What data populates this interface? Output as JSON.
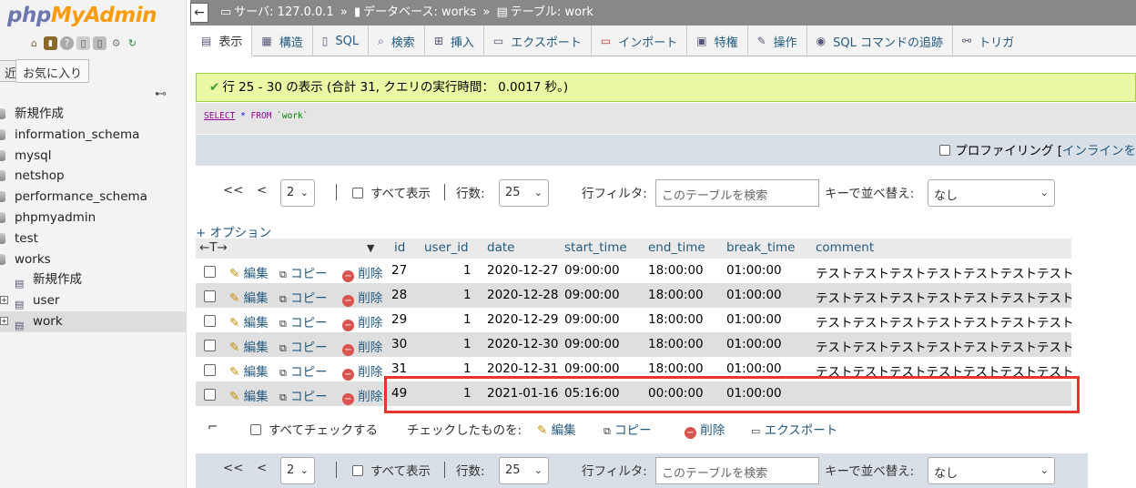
{
  "sidebar": {
    "logo_php": "php",
    "logo_myadmin": "MyAdmin",
    "recent_tab": "近",
    "favorites_tab": "お気に入り",
    "tree": [
      {
        "label": "新規作成"
      },
      {
        "label": "information_schema"
      },
      {
        "label": "mysql"
      },
      {
        "label": "netshop"
      },
      {
        "label": "performance_schema"
      },
      {
        "label": "phpmyadmin"
      },
      {
        "label": "test"
      },
      {
        "label": "works"
      }
    ],
    "subtree": [
      {
        "label": "新規作成"
      },
      {
        "label": "user"
      },
      {
        "label": "work"
      }
    ]
  },
  "topbar": {
    "server": "サーバ: 127.0.0.1",
    "database": "データベース: works",
    "table": "テーブル: work"
  },
  "tabs": [
    {
      "label": "表示",
      "icon": "browse-icon"
    },
    {
      "label": "構造",
      "icon": "structure-icon"
    },
    {
      "label": "SQL",
      "icon": "sql-icon"
    },
    {
      "label": "検索",
      "icon": "search-icon"
    },
    {
      "label": "挿入",
      "icon": "insert-icon"
    },
    {
      "label": "エクスポート",
      "icon": "export-icon"
    },
    {
      "label": "インポート",
      "icon": "import-icon"
    },
    {
      "label": "特権",
      "icon": "privileges-icon"
    },
    {
      "label": "操作",
      "icon": "operations-icon"
    },
    {
      "label": "SQL コマンドの追跡",
      "icon": "tracking-icon"
    },
    {
      "label": "トリガ",
      "icon": "triggers-icon"
    }
  ],
  "message": {
    "text": "行 25 - 30 の表示 (合計 31, クエリの実行時間： 0.0017 秒。)"
  },
  "sql": {
    "select": "SELECT",
    "star": "*",
    "from": "FROM",
    "table": "`work`"
  },
  "profiling": {
    "label": "プロファイリング",
    "bracket_open": "[",
    "inline": "インラインを"
  },
  "navigation": {
    "first": "<<",
    "prev": "<",
    "page": "2",
    "show_all": "すべて表示",
    "rows_label": "行数:",
    "rows_value": "25",
    "filter_label": "行フィルタ:",
    "filter_placeholder": "このテーブルを検索",
    "sort_label": "キーで並べ替え:",
    "sort_value": "なし"
  },
  "options_link": "+ オプション",
  "table": {
    "arrows": "←T→",
    "columns": [
      "id",
      "user_id",
      "date",
      "start_time",
      "end_time",
      "break_time",
      "comment"
    ],
    "actions": {
      "edit": "編集",
      "copy": "コピー",
      "delete": "削除"
    },
    "rows": [
      {
        "id": "27",
        "user_id": "1",
        "date": "2020-12-27",
        "start_time": "09:00:00",
        "end_time": "18:00:00",
        "break_time": "01:00:00",
        "comment": "テストテストテストテストテストテストテスト"
      },
      {
        "id": "28",
        "user_id": "1",
        "date": "2020-12-28",
        "start_time": "09:00:00",
        "end_time": "18:00:00",
        "break_time": "01:00:00",
        "comment": "テストテストテストテストテストテストテスト"
      },
      {
        "id": "29",
        "user_id": "1",
        "date": "2020-12-29",
        "start_time": "09:00:00",
        "end_time": "18:00:00",
        "break_time": "01:00:00",
        "comment": "テストテストテストテストテストテストテスト"
      },
      {
        "id": "30",
        "user_id": "1",
        "date": "2020-12-30",
        "start_time": "09:00:00",
        "end_time": "18:00:00",
        "break_time": "01:00:00",
        "comment": "テストテストテストテストテストテストテスト"
      },
      {
        "id": "31",
        "user_id": "1",
        "date": "2020-12-31",
        "start_time": "09:00:00",
        "end_time": "18:00:00",
        "break_time": "01:00:00",
        "comment": "テストテストテストテストテストテストテスト"
      },
      {
        "id": "49",
        "user_id": "1",
        "date": "2021-01-16",
        "start_time": "05:16:00",
        "end_time": "00:00:00",
        "break_time": "01:00:00",
        "comment": ""
      }
    ]
  },
  "bulk": {
    "check_all": "すべてチェックする",
    "with_selected": "チェックしたものを:",
    "edit": "編集",
    "copy": "コピー",
    "delete": "削除",
    "export": "エクスポート"
  },
  "colors": {
    "highlight": "#e8362f",
    "link": "#235a81",
    "success_bg": "#ebf8a4"
  }
}
